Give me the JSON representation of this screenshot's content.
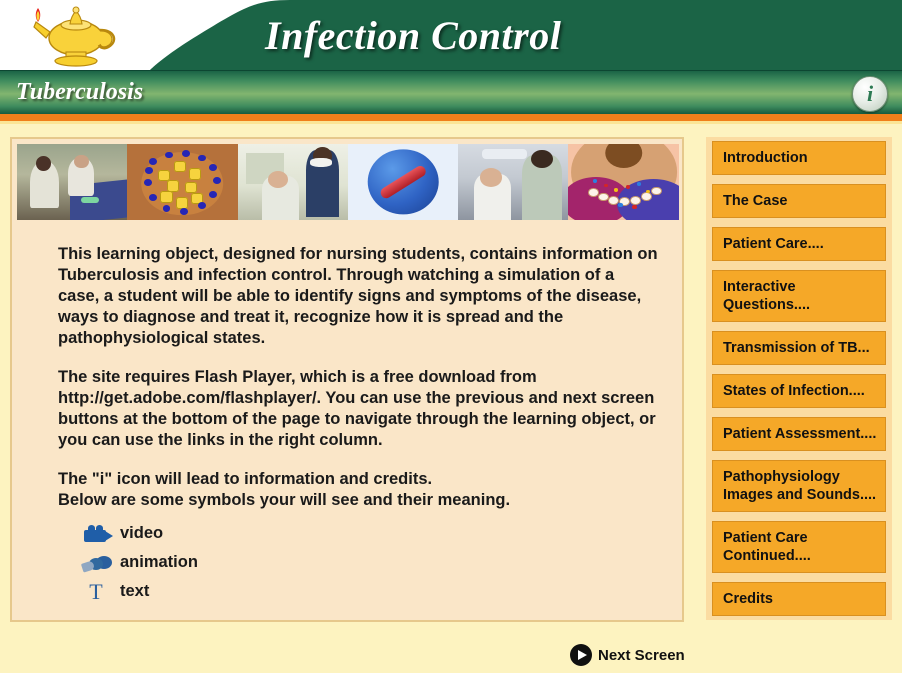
{
  "header": {
    "title": "Infection Control",
    "logo_icon": "nursing-lamp-icon",
    "subtitle": "Tuberculosis",
    "info_icon_label": "i"
  },
  "thumbnails": [
    {
      "alt": "nurse-with-patient-in-bed-photo"
    },
    {
      "alt": "tubercle-formation-diagram"
    },
    {
      "alt": "clinician-greeting-patient-photo"
    },
    {
      "alt": "tuberculosis-bacillus-illustration"
    },
    {
      "alt": "patient-examination-photo"
    },
    {
      "alt": "alveoli-pathophysiology-illustration"
    }
  ],
  "main": {
    "paragraphs": [
      "This learning object, designed for nursing students, contains information on Tuberculosis and infection control. Through watching a simulation of a case, a student will be able to identify signs and symptoms of the disease, ways to diagnose and treat it, recognize how it is spread and the pathophysiological states.",
      "The site requires Flash Player, which is a free download from http://get.adobe.com/flashplayer/. You can use the previous and next screen buttons at the bottom of the page to navigate through the learning object, or you can use the links in the right column.",
      "The \"i\" icon will lead to information and credits.",
      "Below are some symbols your will see and their meaning."
    ],
    "legend": [
      {
        "icon": "video-camera-icon",
        "label": "video"
      },
      {
        "icon": "animation-icon",
        "label": "animation"
      },
      {
        "icon": "text-icon",
        "label": "text"
      }
    ]
  },
  "nav": {
    "items": [
      {
        "label": "Introduction"
      },
      {
        "label": "The Case"
      },
      {
        "label": "Patient Care...."
      },
      {
        "label": "Interactive Questions...."
      },
      {
        "label": "Transmission of TB..."
      },
      {
        "label": "States of Infection...."
      },
      {
        "label": "Patient Assessment...."
      },
      {
        "label": "Pathophysiology Images and Sounds...."
      },
      {
        "label": "Patient Care Continued...."
      },
      {
        "label": "Credits"
      }
    ]
  },
  "footer": {
    "next_label": "Next Screen",
    "next_icon": "play-circle-icon"
  },
  "colors": {
    "header_green": "#1b6446",
    "accent_orange": "#f07f1a",
    "nav_button": "#f5a828",
    "nav_panel": "#fbdca2",
    "page_background": "#fdf3c0",
    "content_panel": "#fae6c8"
  }
}
